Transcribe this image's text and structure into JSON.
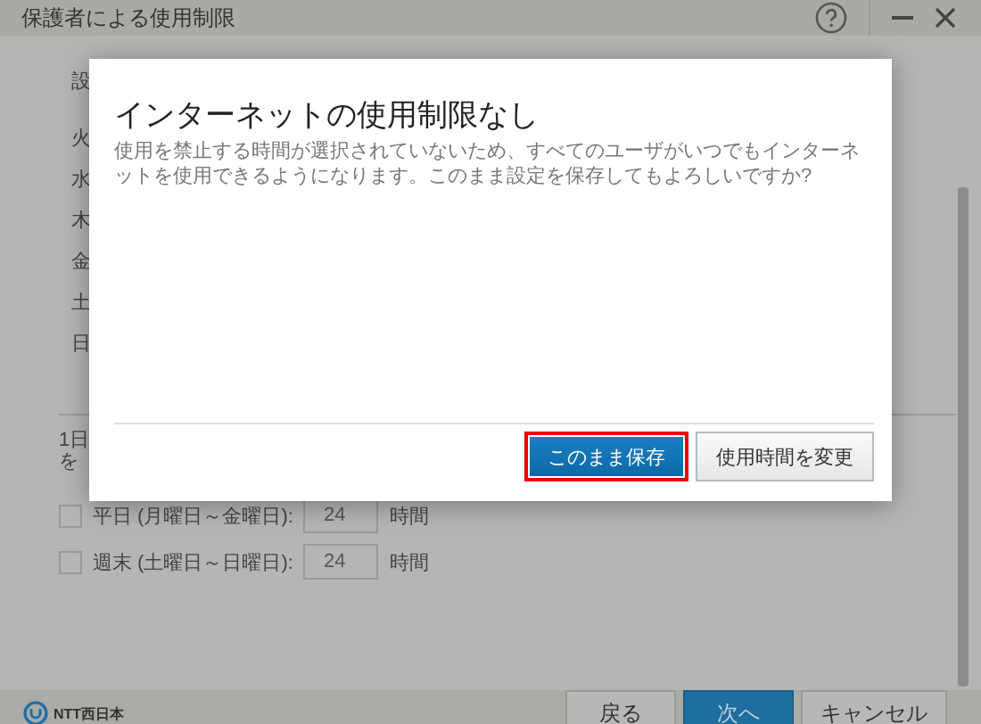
{
  "window": {
    "title": "保護者による使用制限"
  },
  "background": {
    "heading": "設",
    "days": [
      "火",
      "水",
      "木",
      "金",
      "土",
      "日"
    ],
    "limit_label": [
      "1日",
      "を"
    ],
    "limits": [
      {
        "label": "平日 (月曜日～金曜日):",
        "checked": false,
        "value": "24",
        "unit": "時間"
      },
      {
        "label": "週末 (土曜日～日曜日):",
        "checked": false,
        "value": "24",
        "unit": "時間"
      }
    ]
  },
  "dialog": {
    "title": "インターネットの使用制限なし",
    "message": "使用を禁止する時間が選択されていないため、すべてのユーザがいつでもインターネットを使用できるようになります。このまま設定を保存してもよろしいですか?",
    "buttons": [
      {
        "label": "このまま保存",
        "kind": "primary",
        "highlighted": true
      },
      {
        "label": "使用時間を変更",
        "kind": "secondary",
        "highlighted": false
      }
    ]
  },
  "footer": {
    "logo": "NTT西日本",
    "buttons": [
      {
        "label": "戻る",
        "kind": "secondary"
      },
      {
        "label": "次へ",
        "kind": "primary"
      },
      {
        "label": "キャンセル",
        "kind": "secondary"
      }
    ]
  }
}
